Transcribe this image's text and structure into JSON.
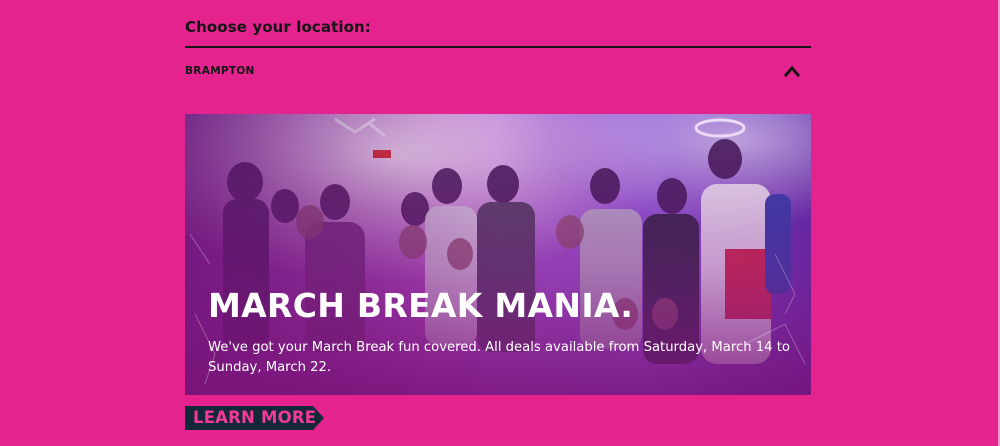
{
  "location_picker": {
    "heading": "Choose your location:",
    "selected_location": "BRAMPTON",
    "toggle_icon": "chevron-up-icon"
  },
  "promo": {
    "title": "MARCH BREAK MANIA.",
    "description": "We've got your March Break fun covered. All deals available from Saturday, March 14 to Sunday, March 22.",
    "image": "group-of-teens-photo",
    "cta_label": "LEARN MORE"
  },
  "colors": {
    "page_background": "#e5238e",
    "text_dark": "#151515",
    "cta_background": "#142839",
    "cta_text": "#f23a99",
    "banner_overlay": "#8a1a86"
  }
}
